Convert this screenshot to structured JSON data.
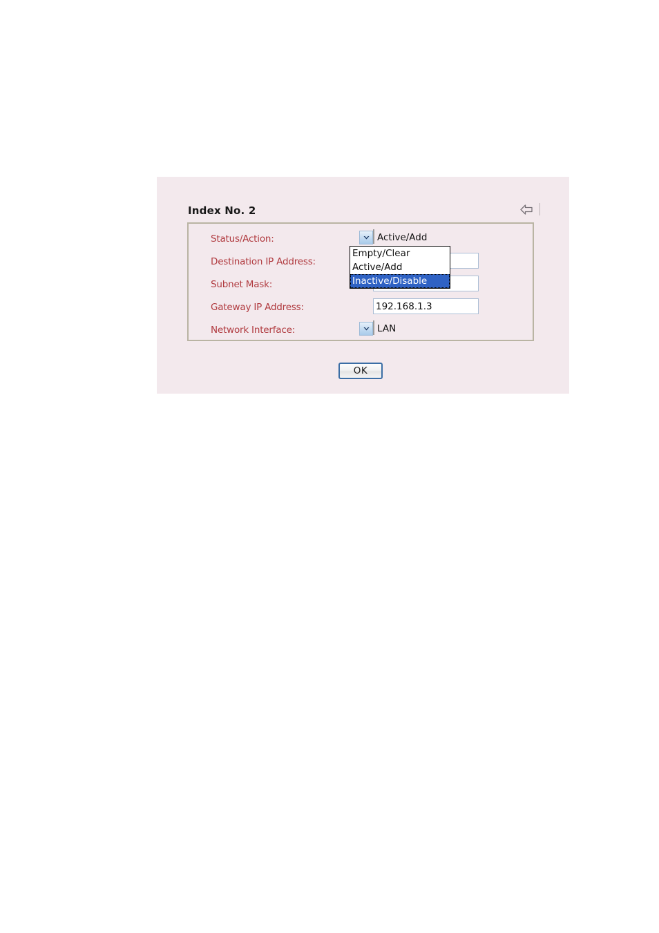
{
  "panel": {
    "title": "Index No. 2",
    "background_color": "#f3e9ed",
    "label_color": "#b03a3f",
    "fieldset_border_color": "#b9b4a3"
  },
  "header": {
    "back_arrow_icon": "back-arrow-icon"
  },
  "form": {
    "rows": [
      {
        "label": "Status/Action:",
        "control": "select",
        "value": "Active/Add"
      },
      {
        "label": "Destination IP Address:",
        "control": "text",
        "value": "",
        "placeholder": ""
      },
      {
        "label": "Subnet Mask:",
        "control": "text",
        "value": "",
        "placeholder": ""
      },
      {
        "label": "Gateway IP Address:",
        "control": "text",
        "value": "192.168.1.3",
        "placeholder": ""
      },
      {
        "label": "Network Interface:",
        "control": "select",
        "value": "LAN"
      }
    ]
  },
  "status_dropdown": {
    "open": true,
    "options": [
      {
        "label": "Empty/Clear",
        "selected": false
      },
      {
        "label": "Active/Add",
        "selected": false
      },
      {
        "label": "Inactive/Disable",
        "selected": true
      }
    ],
    "highlight_color": "#2f62c4",
    "highlight_text_color": "#ffffff"
  },
  "actions": {
    "ok_label": "OK",
    "ok_border_color": "#3b6ea5"
  }
}
